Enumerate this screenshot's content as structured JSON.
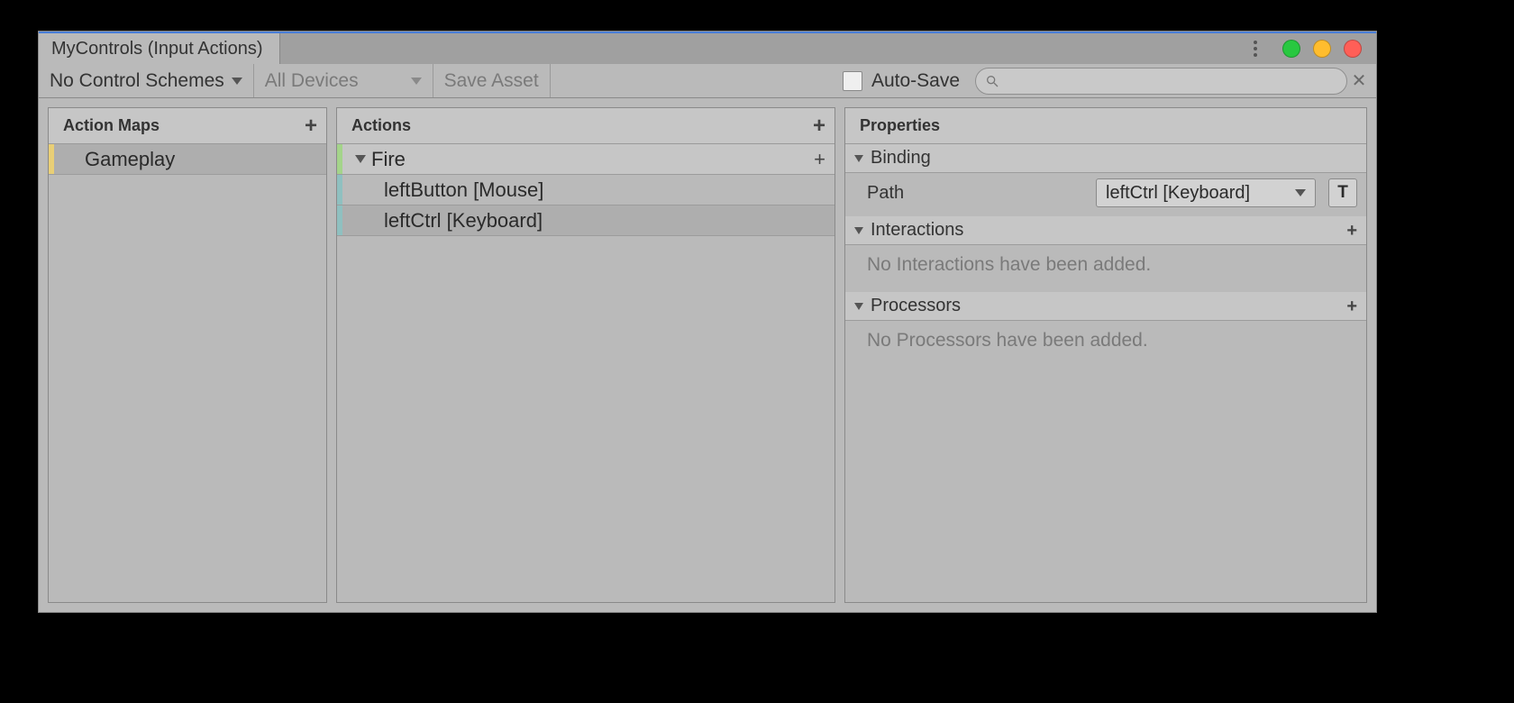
{
  "window": {
    "tab_title": "MyControls (Input Actions)"
  },
  "toolbar": {
    "control_schemes": "No Control Schemes",
    "devices": "All Devices",
    "save_asset": "Save Asset",
    "auto_save": "Auto-Save",
    "search_placeholder": ""
  },
  "panel_labels": {
    "action_maps": "Action Maps",
    "actions": "Actions",
    "properties": "Properties"
  },
  "action_maps": [
    {
      "name": "Gameplay",
      "selected": true
    }
  ],
  "actions": [
    {
      "name": "Fire",
      "expanded": true,
      "bindings": [
        {
          "name": "leftButton [Mouse]",
          "selected": false
        },
        {
          "name": "leftCtrl [Keyboard]",
          "selected": true
        }
      ]
    }
  ],
  "properties": {
    "binding_header": "Binding",
    "path_label": "Path",
    "path_value": "leftCtrl [Keyboard]",
    "listen_button": "T",
    "interactions_header": "Interactions",
    "interactions_empty": "No Interactions have been added.",
    "processors_header": "Processors",
    "processors_empty": "No Processors have been added."
  }
}
